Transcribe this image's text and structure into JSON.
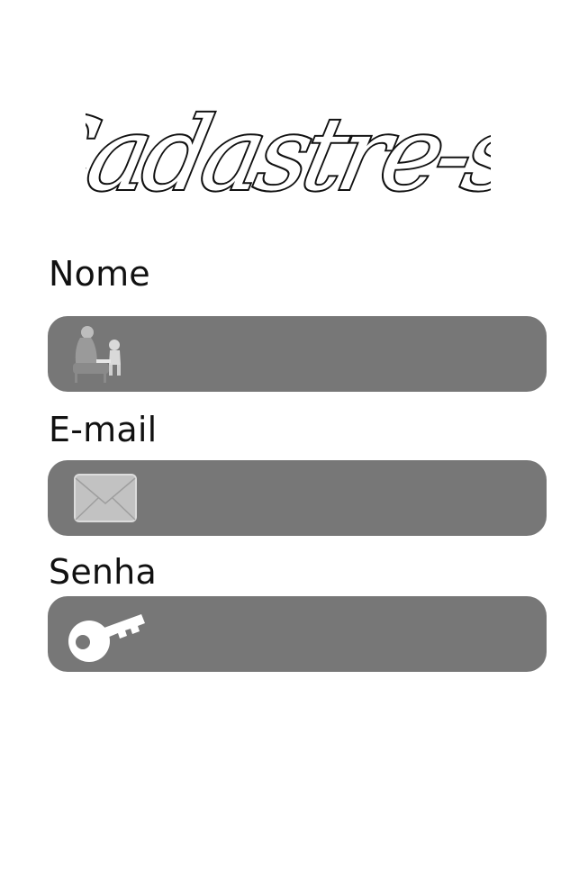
{
  "header": {
    "title": "Cadastre-se"
  },
  "form": {
    "fields": [
      {
        "label": "Nome",
        "value": "",
        "icon": "person-at-desk-icon"
      },
      {
        "label": "E-mail",
        "value": "",
        "icon": "envelope-icon"
      },
      {
        "label": "Senha",
        "value": "",
        "icon": "key-icon"
      }
    ]
  },
  "colors": {
    "background": "#ffffff",
    "field_background": "#777777",
    "label_text": "#111111",
    "title_ink": "#111111"
  }
}
